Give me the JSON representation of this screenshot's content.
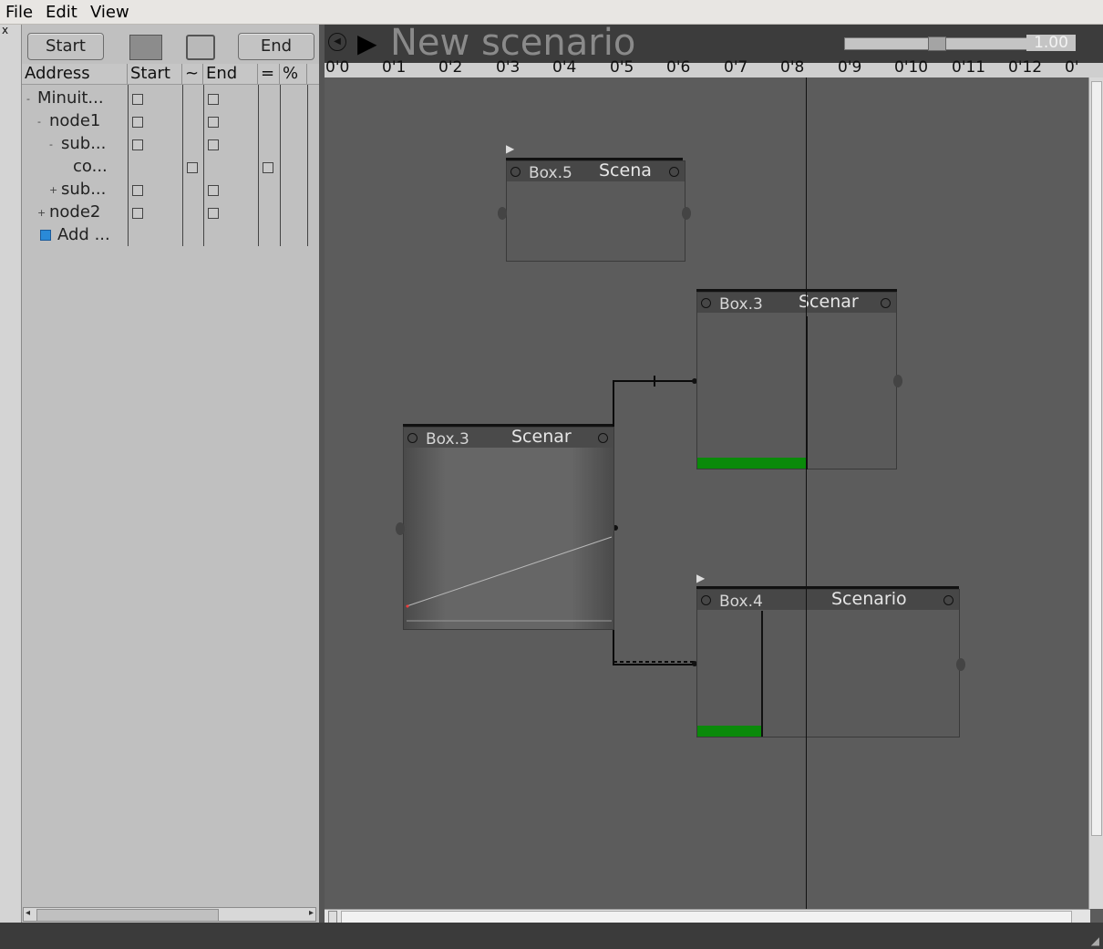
{
  "menu": {
    "file_label": "File",
    "edit_label": "Edit",
    "view_label": "View"
  },
  "left_panel": {
    "close_label": "x",
    "start_label": "Start",
    "end_label": "End",
    "columns": [
      "Address",
      "Start",
      "~",
      "End",
      "=",
      "%"
    ],
    "tree": [
      {
        "label": "Minuit...",
        "expander": "-",
        "start": true,
        "end": true
      },
      {
        "label": "node1",
        "expander": "-",
        "start": true,
        "end": true
      },
      {
        "label": "sub...",
        "expander": "-",
        "start": true,
        "end": true
      },
      {
        "label": "co...",
        "expander": "",
        "start": true,
        "end": true
      },
      {
        "label": "sub...",
        "expander": "+",
        "start": true,
        "end": true
      },
      {
        "label": "node2",
        "expander": "+",
        "start": true,
        "end": true
      },
      {
        "label": "Add ...",
        "expander": "+",
        "start": false,
        "end": false
      }
    ]
  },
  "scenario": {
    "title": "New scenario",
    "speed_value": "1.00",
    "speed_fraction": 0.5,
    "ruler_labels": [
      "0'0",
      "0'1",
      "0'2",
      "0'3",
      "0'4",
      "0'5",
      "0'6",
      "0'7",
      "0'8",
      "0'9",
      "0'10",
      "0'11",
      "0'12",
      "0'"
    ],
    "boxes": [
      {
        "id": "box5",
        "name": "Box.5",
        "type": "Scena"
      },
      {
        "id": "box3a",
        "name": "Box.3",
        "type": "Scenar"
      },
      {
        "id": "box3b",
        "name": "Box.3",
        "type": "Scenar"
      },
      {
        "id": "box4",
        "name": "Box.4",
        "type": "Scenario"
      }
    ]
  },
  "colors": {
    "progress": "#0a8a0a",
    "canvas": "#5c5c5c"
  }
}
